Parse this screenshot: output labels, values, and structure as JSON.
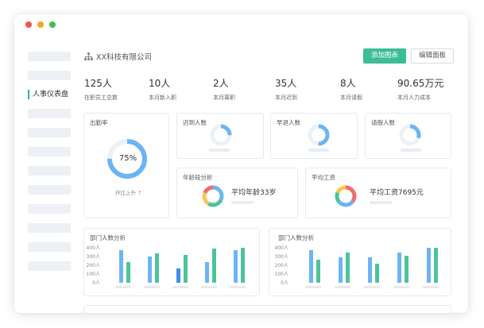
{
  "window": {
    "dots": [
      {
        "name": "close",
        "color": "#f0544f"
      },
      {
        "name": "minimize",
        "color": "#f5a623"
      },
      {
        "name": "maximize",
        "color": "#3fbf4a"
      }
    ]
  },
  "sidebar": {
    "active_label": "人事仪表盘"
  },
  "header": {
    "company": "XX科技有限公司",
    "add_chart": "添加图表",
    "edit_panel": "编辑面板"
  },
  "stats": [
    {
      "value": "125人",
      "label": "在职员工总数"
    },
    {
      "value": "10人",
      "label": "本月新入职"
    },
    {
      "value": "2人",
      "label": "本月离职"
    },
    {
      "value": "35人",
      "label": "本月迟到"
    },
    {
      "value": "8人",
      "label": "本月请假"
    },
    {
      "value": "90.65万元",
      "label": "本月人力成本"
    }
  ],
  "attendance": {
    "title": "出勤率",
    "percent_text": "75%",
    "percent": 75,
    "yoy_label": "环比上升",
    "arrow": "↑"
  },
  "small_cards": [
    {
      "title": "迟到人数",
      "fraction": 0.25
    },
    {
      "title": "早退人数",
      "fraction": 0.5
    },
    {
      "title": "请假人数",
      "fraction": 0.3
    }
  ],
  "age": {
    "title": "年龄段分析",
    "text": "平均年龄33岁"
  },
  "salary": {
    "title": "平均工资",
    "text": "平均工资7695元"
  },
  "colors": {
    "primary": "#3dbd94",
    "blue": "#6cb4f5",
    "green": "#4cc49a",
    "dark_blue": "#3d8fe8",
    "track": "#edf0f4"
  },
  "chart_data": [
    {
      "type": "bar",
      "title": "部门人数分析",
      "y_ticks": [
        "400人",
        "300人",
        "200人",
        "100人",
        "0人"
      ],
      "ylim": [
        0,
        400
      ],
      "series": [
        {
          "values": [
            370,
            300,
            160,
            240,
            370
          ]
        },
        {
          "values": [
            240,
            340,
            320,
            390,
            400
          ]
        }
      ]
    },
    {
      "type": "bar",
      "title": "部门人数分析",
      "y_ticks": [
        "400人",
        "300人",
        "200人",
        "100人",
        "0人"
      ],
      "ylim": [
        0,
        400
      ],
      "series": [
        {
          "values": [
            370,
            290,
            290,
            350,
            460
          ]
        },
        {
          "values": [
            260,
            350,
            220,
            310,
            420
          ]
        }
      ]
    }
  ]
}
